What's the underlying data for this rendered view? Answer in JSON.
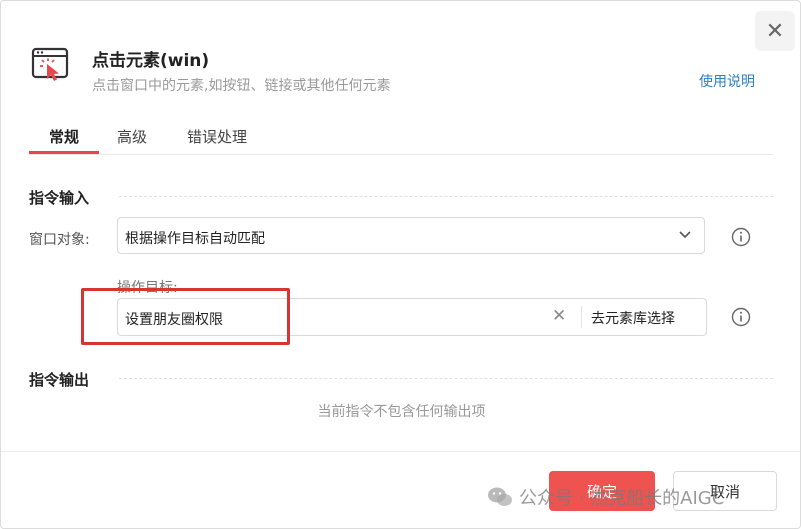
{
  "dialog": {
    "close_symbol": "✕",
    "title": "点击元素(win)",
    "subtitle": "点击窗口中的元素,如按钮、链接或其他任何元素",
    "help_link": "使用说明"
  },
  "tabs": [
    {
      "label": "常规",
      "active": true
    },
    {
      "label": "高级",
      "active": false
    },
    {
      "label": "错误处理",
      "active": false
    }
  ],
  "input_section": {
    "title": "指令输入",
    "window_label": "窗口对象:",
    "window_value": "根据操作目标自动匹配",
    "target_label": "操作目标:",
    "target_value": "设置朋友圈权限",
    "clear_symbol": "✕",
    "pick_button": "去元素库选择"
  },
  "output_section": {
    "title": "指令输出",
    "empty_text": "当前指令不包含任何输出项"
  },
  "footer": {
    "confirm": "确定",
    "cancel": "取消"
  },
  "watermark": {
    "text": "公众号 · 杰克船长的AIGC"
  },
  "colors": {
    "accent": "#ef5350",
    "link": "#2f7fc1",
    "highlight_box": "#d83434"
  },
  "icons": [
    "click-element-icon",
    "close-icon",
    "chevron-down-icon",
    "info-icon",
    "wechat-icon"
  ]
}
